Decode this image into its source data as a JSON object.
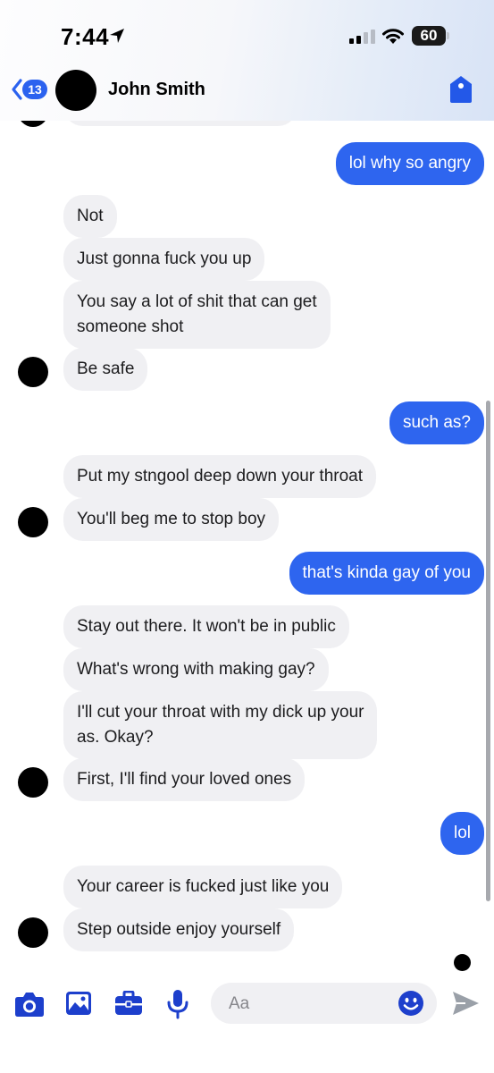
{
  "status_bar": {
    "time": "7:44",
    "battery": "60"
  },
  "header": {
    "back_badge": "13",
    "contact_name": "John Smith"
  },
  "messages": [
    {
      "side": "out",
      "text": "lol why so angry"
    },
    {
      "side": "in",
      "text": "Not"
    },
    {
      "side": "in",
      "text": "Just gonna fuck you up"
    },
    {
      "side": "in",
      "lines": [
        "You say a lot of shit that can get",
        "someone shot"
      ]
    },
    {
      "side": "in",
      "text": "Be safe"
    },
    {
      "side": "out",
      "text": "such as?"
    },
    {
      "side": "in",
      "text": "Put my stngool deep down your throat"
    },
    {
      "side": "in",
      "text": "You'll beg me to stop boy"
    },
    {
      "side": "out",
      "text": "that's kinda gay of you"
    },
    {
      "side": "in",
      "text": "Stay out there. It won't be in public"
    },
    {
      "side": "in",
      "text": "What's wrong with making gay?"
    },
    {
      "side": "in",
      "lines": [
        "I'll cut your throat with my dick up your",
        "as. Okay?"
      ]
    },
    {
      "side": "in",
      "text": "First, I'll find your loved ones"
    },
    {
      "side": "out",
      "text": "lol"
    },
    {
      "side": "in",
      "text": "Your career is fucked just like you"
    },
    {
      "side": "in",
      "text": "Step outside enjoy yourself"
    }
  ],
  "input": {
    "placeholder": "Aa"
  },
  "colors": {
    "accent": "#2e65ef",
    "incoming_bubble": "#f0f0f3",
    "icon_blue": "#1d3fcc"
  },
  "icons": {
    "back": "chevron-left-icon",
    "tag": "tag-icon",
    "camera": "camera-icon",
    "gallery": "image-icon",
    "briefcase": "briefcase-icon",
    "mic": "microphone-icon",
    "emoji": "emoji-icon",
    "send": "send-icon"
  }
}
